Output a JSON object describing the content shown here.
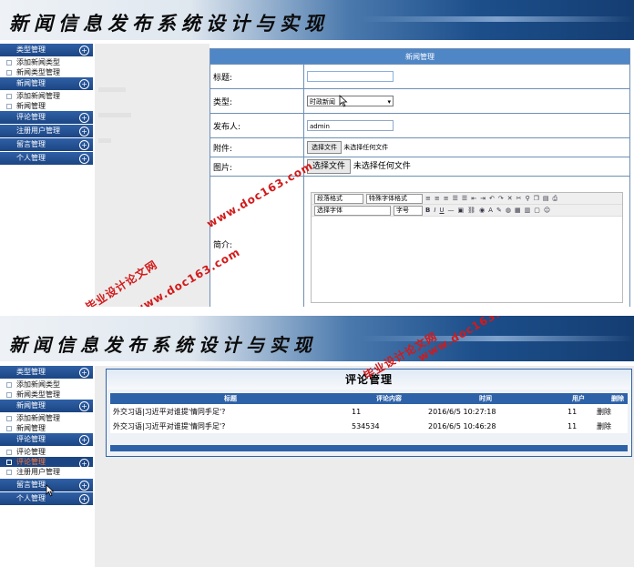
{
  "app_title": "新闻信息发布系统设计与实现",
  "sidebar": {
    "groups": [
      {
        "label": "类型管理",
        "items": [
          "添加新闻类型",
          "新闻类型管理"
        ]
      },
      {
        "label": "新闻管理",
        "items": [
          "添加新闻管理",
          "新闻管理"
        ]
      },
      {
        "label": "评论管理",
        "items": [
          "评论管理",
          "评论管理"
        ]
      },
      {
        "label": "注册用户管理",
        "items": [
          "注册用户管理"
        ]
      },
      {
        "label": "留言管理"
      },
      {
        "label": "个人管理"
      }
    ]
  },
  "news_form": {
    "header": "新闻管理",
    "fields": {
      "title": {
        "label": "标题:",
        "value": ""
      },
      "type": {
        "label": "类型:",
        "value": "时政新闻"
      },
      "publisher": {
        "label": "发布人:",
        "value": "admin"
      },
      "attachment": {
        "label": "附件:",
        "button": "选择文件",
        "status": "未选择任何文件"
      },
      "image": {
        "label": "图片:",
        "button": "选择文件",
        "status": "未选择任何文件"
      },
      "intro": {
        "label": "简介:"
      }
    },
    "editor_toolbar": {
      "selects": [
        "段落格式",
        "特殊字体格式",
        "选择字体",
        "字号"
      ],
      "bold": "B",
      "italic": "I",
      "underline": "U"
    }
  },
  "comments": {
    "title": "评论管理",
    "columns": [
      "标题",
      "评论内容",
      "时间",
      "用户",
      "删除"
    ],
    "rows": [
      {
        "title": "外交习语|习近平对谁提'情同手足'?",
        "content": "11",
        "time": "2016/6/5 10:27:18",
        "user": "11",
        "delete": "删除"
      },
      {
        "title": "外交习语|习近平对谁提'情同手足'?",
        "content": "534534",
        "time": "2016/6/5 10:46:28",
        "user": "11",
        "delete": "删除"
      }
    ]
  },
  "watermark": {
    "site": "www.doc163.com",
    "label": "毕业设计论文网"
  },
  "colors": {
    "nav_blue": "#1c4583",
    "table_blue": "#2e62a8",
    "form_header": "#4f86c6",
    "watermark_red": "#d21a1a",
    "selected_text": "#ff7a3a"
  }
}
